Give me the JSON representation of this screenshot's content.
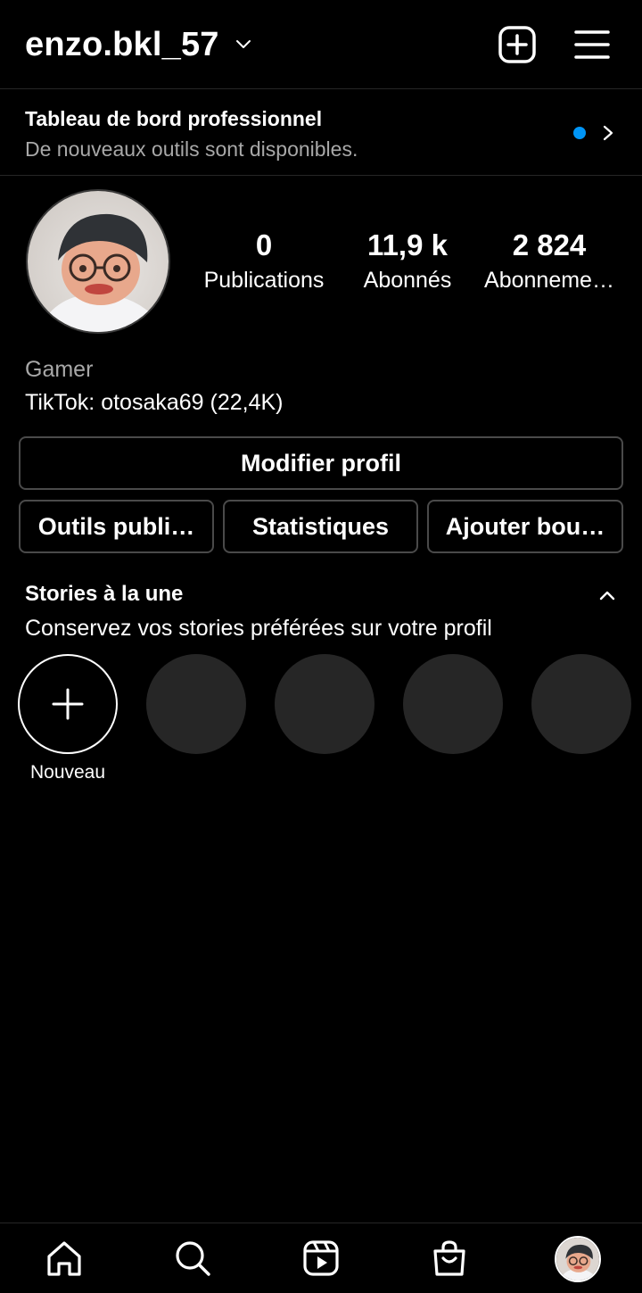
{
  "header": {
    "username": "enzo.bkl_57",
    "icons": [
      "chevron-down-icon",
      "add-post-icon",
      "hamburger-menu-icon"
    ]
  },
  "dashboard": {
    "title": "Tableau de bord professionnel",
    "subtitle": "De nouveaux outils sont disponibles.",
    "dot_color": "#0095f6"
  },
  "profile": {
    "stats": [
      {
        "value": "0",
        "label": "Publications"
      },
      {
        "value": "11,9 k",
        "label": "Abonnés"
      },
      {
        "value": "2 824",
        "label": "Abonneme…"
      }
    ],
    "category": "Gamer",
    "bio": "TikTok: otosaka69 (22,4K)"
  },
  "actions": {
    "edit_profile": "Modifier profil",
    "promo_tools": "Outils publi…",
    "insights": "Statistiques",
    "add_button": "Ajouter bou…"
  },
  "highlights": {
    "title": "Stories à la une",
    "subtitle": "Conservez vos stories préférées sur votre profil",
    "new_label": "Nouveau"
  },
  "bottom_nav": {
    "items": [
      "home-icon",
      "search-icon",
      "reels-icon",
      "shop-icon",
      "profile-avatar"
    ]
  },
  "colors": {
    "background": "#000000",
    "accent": "#0095f6",
    "secondary_text": "#a8a8a8",
    "placeholder": "#262626"
  }
}
